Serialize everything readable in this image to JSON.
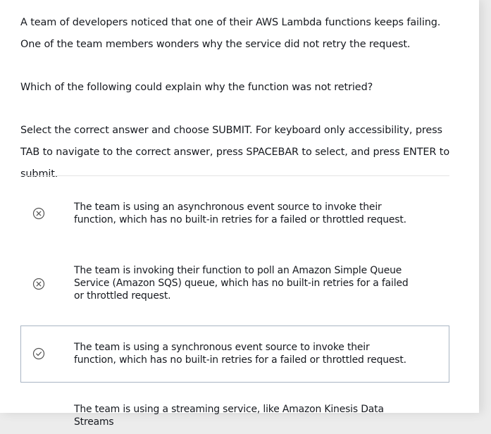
{
  "question": {
    "intro": "A team of developers noticed that one of their AWS Lambda functions keeps failing. One of the team members wonders why the service did not retry the request.",
    "prompt": "Which of the following could explain why the function was not retried?",
    "instructions": "Select the correct answer and choose SUBMIT. For keyboard only accessibility, press TAB to navigate to the correct answer, press SPACEBAR to select, and press ENTER to submit."
  },
  "options": [
    {
      "text": "The team is using an asynchronous event source to invoke their function, which has no built-in retries for a failed or throttled request.",
      "state": "incorrect",
      "icon": "x-circle-icon"
    },
    {
      "text": "The team is invoking their function to poll an Amazon Simple Queue Service (Amazon SQS) queue, which has no built-in retries for a failed or throttled request.",
      "state": "incorrect",
      "icon": "x-circle-icon"
    },
    {
      "text": "The team is using a synchronous event source to invoke their function, which has no built-in retries for a failed or throttled request.",
      "state": "correct",
      "icon": "check-circle-icon"
    },
    {
      "text": "The team is using a streaming service, like Amazon Kinesis Data Streams",
      "state": "none",
      "icon": ""
    }
  ],
  "colors": {
    "page_background": "#ececec",
    "card_background": "#ffffff",
    "text": "#16191f",
    "icon": "#555555",
    "selected_border": "#a9b5c3",
    "divider": "#e3e3e3"
  }
}
